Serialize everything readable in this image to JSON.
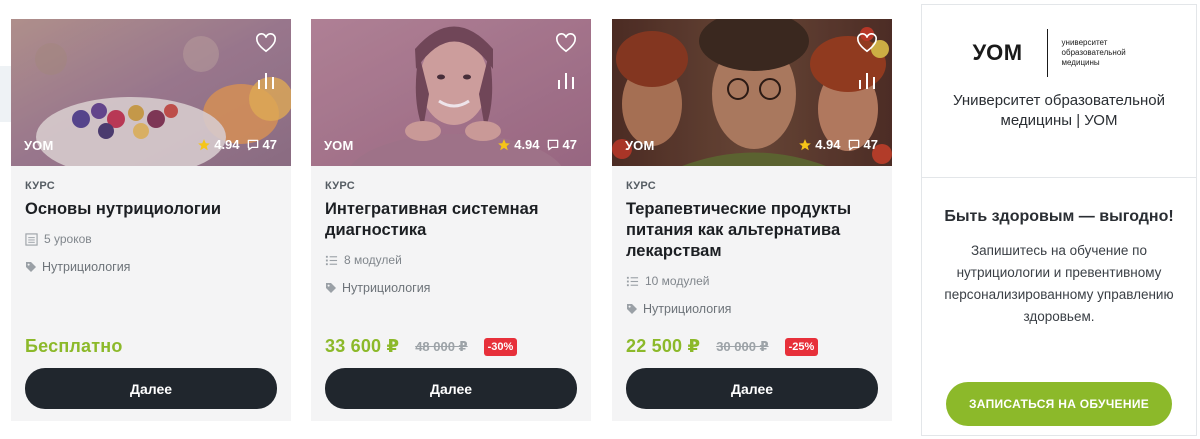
{
  "cards": [
    {
      "provider": "УОМ",
      "rating": "4.94",
      "reviews": "47",
      "kind": "КУРС",
      "title": "Основы нутрициологии",
      "meta": "5 уроков",
      "meta_icon": "lessons-icon",
      "tag": "Нутрициология",
      "price": "Бесплатно",
      "old_price": "",
      "discount": "",
      "button": "Далее"
    },
    {
      "provider": "УОМ",
      "rating": "4.94",
      "reviews": "47",
      "kind": "КУРС",
      "title": "Интегративная системная диагностика",
      "meta": "8 модулей",
      "meta_icon": "modules-icon",
      "tag": "Нутрициология",
      "price": "33 600 ₽",
      "old_price": "48 000 ₽",
      "discount": "-30%",
      "button": "Далее"
    },
    {
      "provider": "УОМ",
      "rating": "4.94",
      "reviews": "47",
      "kind": "КУРС",
      "title": "Терапевтические продукты питания как альтернатива лекарствам",
      "meta": "10 модулей",
      "meta_icon": "modules-icon",
      "tag": "Нутрициология",
      "price": "22 500 ₽",
      "old_price": "30 000 ₽",
      "discount": "-25%",
      "button": "Далее"
    }
  ],
  "sidebar": {
    "logo_mark": "УОМ",
    "logo_sub": "университет образовательной медицины",
    "org_name": "Университет образовательной медицины | УОМ",
    "promo_title": "Быть здоровым — выгодно!",
    "promo_text": "Запишитесь на обучение по нутрициологии и превентивному персонализированному управлению здоровьем.",
    "cta": "ЗАПИСАТЬСЯ НА ОБУЧЕНИЕ"
  },
  "colors": {
    "accent_green": "#8cb92a",
    "button_dark": "#20262d",
    "discount_red": "#e7303a",
    "star": "#f5c518"
  }
}
